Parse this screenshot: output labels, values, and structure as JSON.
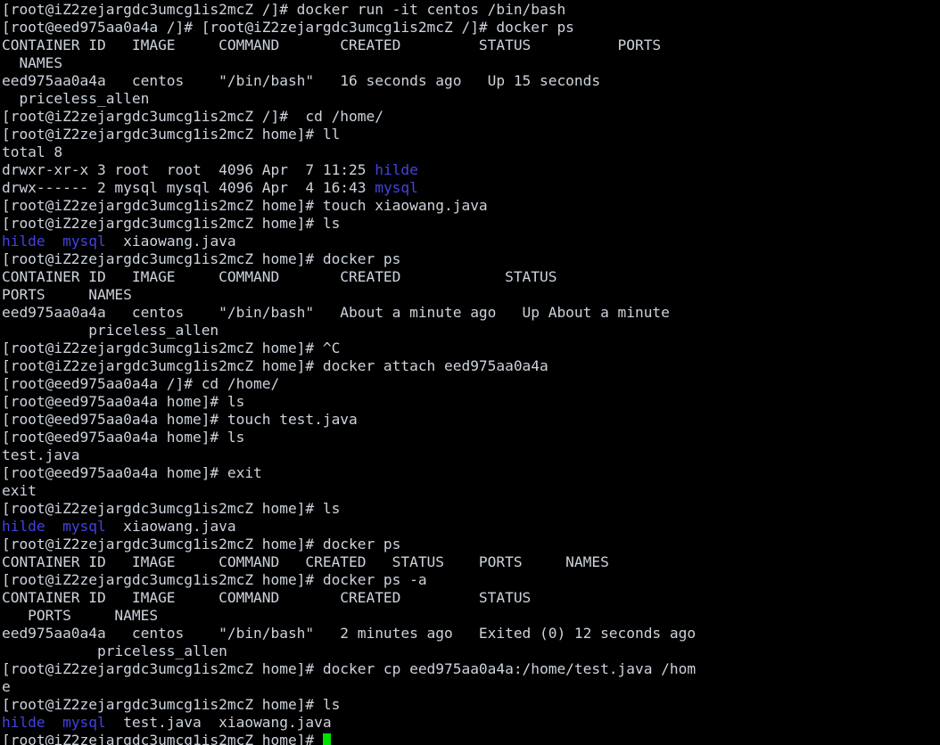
{
  "terminal": {
    "title": "root@iZ2zejargdc3umcg1is2mcZ:/home",
    "colors": {
      "background": "#000000",
      "foreground": "#cdd3dc",
      "directory": "#4343e0",
      "cursor": "#00e000"
    },
    "host_prompt": "[root@iZ2zejargdc3umcg1is2mcZ home]# ",
    "lines": [
      {
        "id": "l01",
        "segments": [
          {
            "text": "[root@iZ2zejargdc3umcg1is2mcZ /]# docker run -it centos /bin/bash",
            "color": "foreground"
          }
        ]
      },
      {
        "id": "l02",
        "segments": [
          {
            "text": "[root@eed975aa0a4a /]# [root@iZ2zejargdc3umcg1is2mcZ /]# docker ps",
            "color": "foreground"
          }
        ]
      },
      {
        "id": "l03",
        "segments": [
          {
            "text": "CONTAINER ID   IMAGE     COMMAND       CREATED         STATUS          PORTS",
            "color": "foreground"
          }
        ]
      },
      {
        "id": "l04",
        "segments": [
          {
            "text": "  NAMES",
            "color": "foreground"
          }
        ]
      },
      {
        "id": "l05",
        "segments": [
          {
            "text": "eed975aa0a4a   centos    \"/bin/bash\"   16 seconds ago   Up 15 seconds",
            "color": "foreground"
          }
        ]
      },
      {
        "id": "l06",
        "segments": [
          {
            "text": "  priceless_allen",
            "color": "foreground"
          }
        ]
      },
      {
        "id": "l07",
        "segments": [
          {
            "text": "[root@iZ2zejargdc3umcg1is2mcZ /]#  cd /home/",
            "color": "foreground"
          }
        ]
      },
      {
        "id": "l08",
        "segments": [
          {
            "text": "[root@iZ2zejargdc3umcg1is2mcZ home]# ll",
            "color": "foreground"
          }
        ]
      },
      {
        "id": "l09",
        "segments": [
          {
            "text": "total 8",
            "color": "foreground"
          }
        ]
      },
      {
        "id": "l10",
        "segments": [
          {
            "text": "drwxr-xr-x 3 root  root  4096 Apr  7 11:25 ",
            "color": "foreground"
          },
          {
            "text": "hilde",
            "color": "directory"
          }
        ]
      },
      {
        "id": "l11",
        "segments": [
          {
            "text": "drwx------ 2 mysql mysql 4096 Apr  4 16:43 ",
            "color": "foreground"
          },
          {
            "text": "mysql",
            "color": "directory"
          }
        ]
      },
      {
        "id": "l12",
        "segments": [
          {
            "text": "[root@iZ2zejargdc3umcg1is2mcZ home]# touch xiaowang.java",
            "color": "foreground"
          }
        ]
      },
      {
        "id": "l13",
        "segments": [
          {
            "text": "[root@iZ2zejargdc3umcg1is2mcZ home]# ls",
            "color": "foreground"
          }
        ]
      },
      {
        "id": "l14",
        "segments": [
          {
            "text": "hilde",
            "color": "directory"
          },
          {
            "text": "  ",
            "color": "foreground"
          },
          {
            "text": "mysql",
            "color": "directory"
          },
          {
            "text": "  xiaowang.java",
            "color": "foreground"
          }
        ]
      },
      {
        "id": "l15",
        "segments": [
          {
            "text": "[root@iZ2zejargdc3umcg1is2mcZ home]# docker ps",
            "color": "foreground"
          }
        ]
      },
      {
        "id": "l16",
        "segments": [
          {
            "text": "CONTAINER ID   IMAGE     COMMAND       CREATED            STATUS",
            "color": "foreground"
          }
        ]
      },
      {
        "id": "l17",
        "segments": [
          {
            "text": "PORTS     NAMES",
            "color": "foreground"
          }
        ]
      },
      {
        "id": "l18",
        "segments": [
          {
            "text": "eed975aa0a4a   centos    \"/bin/bash\"   About a minute ago   Up About a minute",
            "color": "foreground"
          }
        ]
      },
      {
        "id": "l19",
        "segments": [
          {
            "text": "          priceless_allen",
            "color": "foreground"
          }
        ]
      },
      {
        "id": "l20",
        "segments": [
          {
            "text": "[root@iZ2zejargdc3umcg1is2mcZ home]# ^C",
            "color": "foreground"
          }
        ]
      },
      {
        "id": "l21",
        "segments": [
          {
            "text": "[root@iZ2zejargdc3umcg1is2mcZ home]# docker attach eed975aa0a4a",
            "color": "foreground"
          }
        ]
      },
      {
        "id": "l22",
        "segments": [
          {
            "text": "[root@eed975aa0a4a /]# cd /home/",
            "color": "foreground"
          }
        ]
      },
      {
        "id": "l23",
        "segments": [
          {
            "text": "[root@eed975aa0a4a home]# ls",
            "color": "foreground"
          }
        ]
      },
      {
        "id": "l24",
        "segments": [
          {
            "text": "[root@eed975aa0a4a home]# touch test.java",
            "color": "foreground"
          }
        ]
      },
      {
        "id": "l25",
        "segments": [
          {
            "text": "[root@eed975aa0a4a home]# ls",
            "color": "foreground"
          }
        ]
      },
      {
        "id": "l26",
        "segments": [
          {
            "text": "test.java",
            "color": "foreground"
          }
        ]
      },
      {
        "id": "l27",
        "segments": [
          {
            "text": "[root@eed975aa0a4a home]# exit",
            "color": "foreground"
          }
        ]
      },
      {
        "id": "l28",
        "segments": [
          {
            "text": "exit",
            "color": "foreground"
          }
        ]
      },
      {
        "id": "l29",
        "segments": [
          {
            "text": "[root@iZ2zejargdc3umcg1is2mcZ home]# ls",
            "color": "foreground"
          }
        ]
      },
      {
        "id": "l30",
        "segments": [
          {
            "text": "hilde",
            "color": "directory"
          },
          {
            "text": "  ",
            "color": "foreground"
          },
          {
            "text": "mysql",
            "color": "directory"
          },
          {
            "text": "  xiaowang.java",
            "color": "foreground"
          }
        ]
      },
      {
        "id": "l31",
        "segments": [
          {
            "text": "[root@iZ2zejargdc3umcg1is2mcZ home]# docker ps",
            "color": "foreground"
          }
        ]
      },
      {
        "id": "l32",
        "segments": [
          {
            "text": "CONTAINER ID   IMAGE     COMMAND   CREATED   STATUS    PORTS     NAMES",
            "color": "foreground"
          }
        ]
      },
      {
        "id": "l33",
        "segments": [
          {
            "text": "[root@iZ2zejargdc3umcg1is2mcZ home]# docker ps -a",
            "color": "foreground"
          }
        ]
      },
      {
        "id": "l34",
        "segments": [
          {
            "text": "CONTAINER ID   IMAGE     COMMAND       CREATED         STATUS",
            "color": "foreground"
          }
        ]
      },
      {
        "id": "l35",
        "segments": [
          {
            "text": "   PORTS     NAMES",
            "color": "foreground"
          }
        ]
      },
      {
        "id": "l36",
        "segments": [
          {
            "text": "eed975aa0a4a   centos    \"/bin/bash\"   2 minutes ago   Exited (0) 12 seconds ago",
            "color": "foreground"
          }
        ]
      },
      {
        "id": "l37",
        "segments": [
          {
            "text": "           priceless_allen",
            "color": "foreground"
          }
        ]
      },
      {
        "id": "l38",
        "segments": [
          {
            "text": "[root@iZ2zejargdc3umcg1is2mcZ home]# docker cp eed975aa0a4a:/home/test.java /hom",
            "color": "foreground"
          }
        ]
      },
      {
        "id": "l39",
        "segments": [
          {
            "text": "e",
            "color": "foreground"
          }
        ]
      },
      {
        "id": "l40",
        "segments": [
          {
            "text": "[root@iZ2zejargdc3umcg1is2mcZ home]# ls",
            "color": "foreground"
          }
        ]
      },
      {
        "id": "l41",
        "segments": [
          {
            "text": "hilde",
            "color": "directory"
          },
          {
            "text": "  ",
            "color": "foreground"
          },
          {
            "text": "mysql",
            "color": "directory"
          },
          {
            "text": "  test.java  xiaowang.java",
            "color": "foreground"
          }
        ]
      },
      {
        "id": "l42",
        "segments": [
          {
            "text": "[root@iZ2zejargdc3umcg1is2mcZ home]# ",
            "color": "foreground"
          }
        ],
        "cursor": true
      }
    ]
  }
}
